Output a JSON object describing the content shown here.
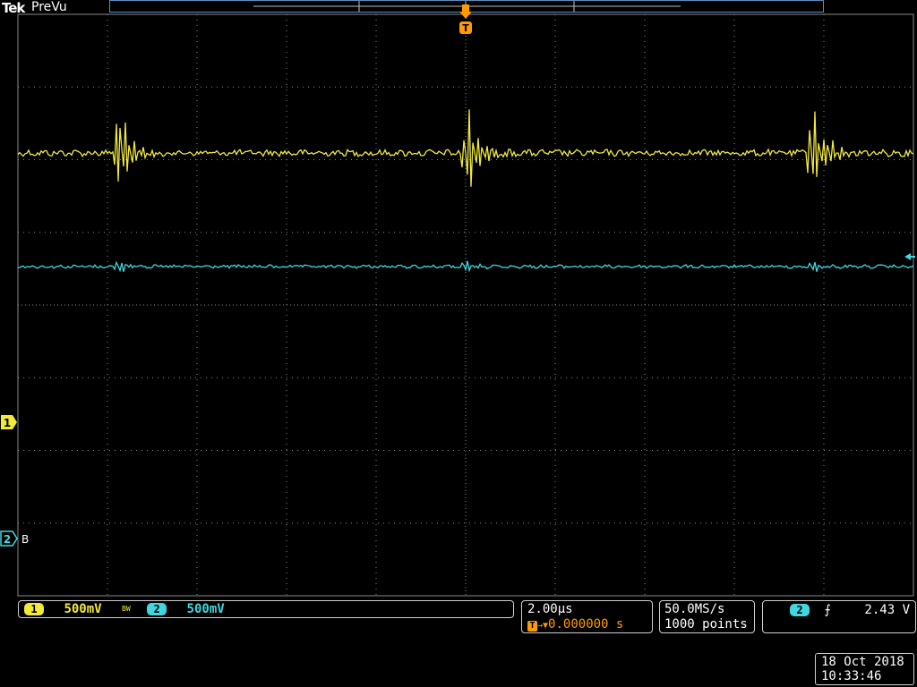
{
  "header": {
    "brand": "Tek",
    "acq_state": "PreVu"
  },
  "markers": {
    "trigger_label": "T",
    "ch1_label": "1",
    "ch2_label": "2",
    "ch2_bandwidth_label": "B"
  },
  "channels": {
    "ch1": {
      "label": "1",
      "scale": "500mV",
      "color": "#f2ea3a"
    },
    "bw_indicator": "BW",
    "ch2": {
      "label": "2",
      "scale": "500mV",
      "color": "#3fd8e0"
    }
  },
  "timebase": {
    "scale": "2.00µs",
    "trigger_icon": "T",
    "delay": "0.000000 s"
  },
  "acquisition": {
    "sample_rate": "50.0MS/s",
    "record_length": "1000 points"
  },
  "trigger": {
    "source": "2",
    "slope_icon": "rising-edge-icon",
    "slope_glyph": "⨍",
    "level": "2.43 V"
  },
  "datetime": {
    "date": "18 Oct  2018",
    "time": "10:33:46"
  },
  "colors": {
    "grid": "#8a8a8a",
    "trigger_orange": "#ff9a00",
    "record_border": "#5b8fbf"
  }
}
